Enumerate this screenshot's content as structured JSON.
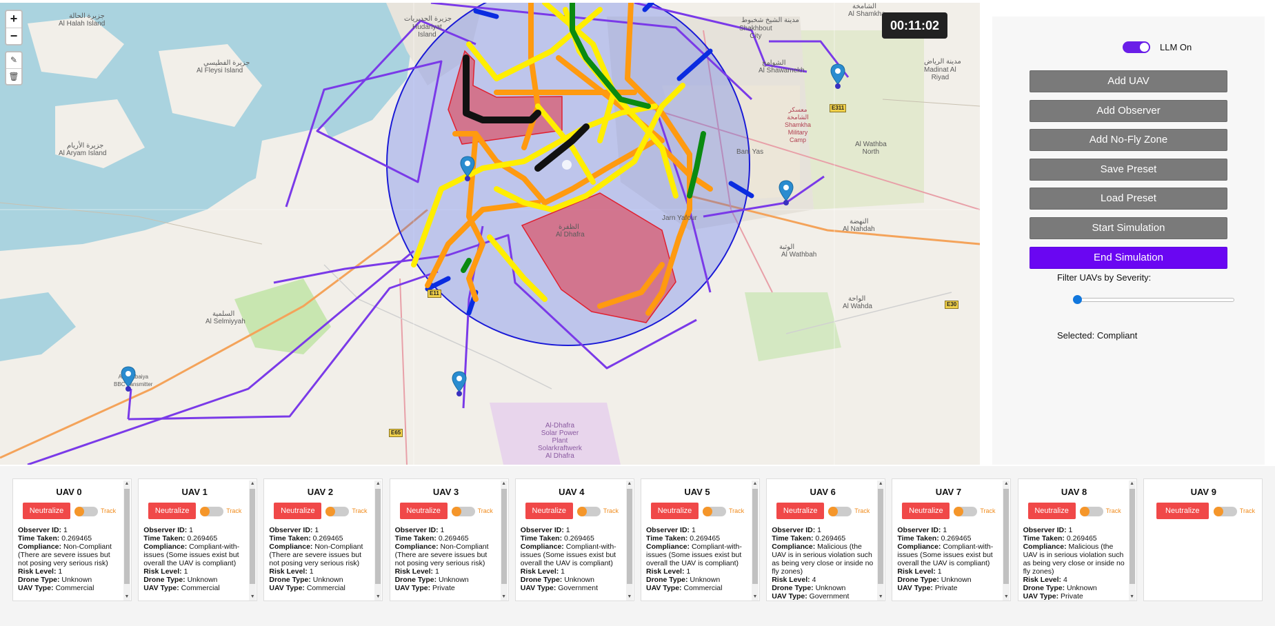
{
  "map": {
    "zoom_in": "+",
    "zoom_out": "−",
    "draw_icon": "edit-icon",
    "delete_icon": "trash-icon",
    "timer": "00:11:02",
    "labels": {
      "halah_ar": "جزيرة الحالة",
      "halah": "Al Halah Island",
      "hudariyat_ar": "جزيرة الحديريات",
      "hudariyat": "Hudariyat\nIsland",
      "fleisi_ar": "جزيرة الفطيسي",
      "fleisi": "Al Fleysi Island",
      "aryam_ar": "جزيرة الأريام",
      "aryam": "Al Aryam Island",
      "selmiyyah_ar": "السلمية",
      "selmiyyah": "Al Selmiyyah",
      "bbc": "Al-Dhabaiya\nBBC transmitter",
      "shamkha_ar": "الشامخة",
      "shamkha": "Al Shamkha",
      "shakhbout_ar": "مدينة الشيخ شخبوط",
      "shakhbout": "Shakhbout\nCity",
      "shawamekh_ar": "الشوامخ",
      "shawamekh": "Al Shawamekh",
      "riyad_ar": "مدينة الرياض",
      "riyad": "Madinat Al\nRiyad",
      "military": "معسكر\nالشامخة\nShamkha\nMilitary\nCamp",
      "wathba_north": "Al Wathba\nNorth",
      "baniyas": "Bani Yas",
      "nahdah_ar": "النهضة",
      "nahdah": "Al Nahdah",
      "wathbah_ar": "الوثبة",
      "wathbah": "Al Wathbah",
      "wahda_ar": "الواحة",
      "wahda": "Al Wahda",
      "dhafra_ar": "الظفرة",
      "dhafra": "Al Dhafra",
      "jarn": "Jarn Yafour",
      "solar": "Al-Dhafra\nSolar Power\nPlant\nSolarkraftwerk\nAl Dhafra",
      "e65": "E65",
      "e30": "E30",
      "e311": "E311",
      "e11": "E11"
    }
  },
  "panel": {
    "llm_label": "LLM On",
    "buttons": {
      "add_uav": "Add UAV",
      "add_observer": "Add Observer",
      "add_nfz": "Add No-Fly Zone",
      "save_preset": "Save Preset",
      "load_preset": "Load Preset",
      "start_sim": "Start Simulation",
      "end_sim": "End Simulation"
    },
    "filter_label": "Filter UAVs by Severity:",
    "slider_value": 0,
    "selected_label": "Selected: Compliant",
    "accent": "#6a06f2"
  },
  "cards": {
    "neutralize_label": "Neutralize",
    "track_label": "Track",
    "field_labels": {
      "observer": "Observer ID:",
      "time": "Time Taken:",
      "compliance": "Compliance:",
      "risk": "Risk Level:",
      "drone": "Drone Type:",
      "uav": "UAV Type:"
    },
    "uavs": [
      {
        "title": "UAV 0",
        "observer": "1",
        "time": "0.269465",
        "compliance": "Non-Compliant (There are severe issues but not posing very serious risk)",
        "risk": "1",
        "drone": "Unknown",
        "uav": "Commercial"
      },
      {
        "title": "UAV 1",
        "observer": "1",
        "time": "0.269465",
        "compliance": "Compliant-with-issues (Some issues exist but overall the UAV is compliant)",
        "risk": "1",
        "drone": "Unknown",
        "uav": "Commercial"
      },
      {
        "title": "UAV 2",
        "observer": "1",
        "time": "0.269465",
        "compliance": "Non-Compliant (There are severe issues but not posing very serious risk)",
        "risk": "1",
        "drone": "Unknown",
        "uav": "Commercial"
      },
      {
        "title": "UAV 3",
        "observer": "1",
        "time": "0.269465",
        "compliance": "Non-Compliant (There are severe issues but not posing very serious risk)",
        "risk": "1",
        "drone": "Unknown",
        "uav": "Private"
      },
      {
        "title": "UAV 4",
        "observer": "1",
        "time": "0.269465",
        "compliance": "Compliant-with-issues (Some issues exist but overall the UAV is compliant)",
        "risk": "1",
        "drone": "Unknown",
        "uav": "Government"
      },
      {
        "title": "UAV 5",
        "observer": "1",
        "time": "0.269465",
        "compliance": "Compliant-with-issues (Some issues exist but overall the UAV is compliant)",
        "risk": "1",
        "drone": "Unknown",
        "uav": "Commercial"
      },
      {
        "title": "UAV 6",
        "observer": "1",
        "time": "0.269465",
        "compliance": "Malicious (the UAV is in serious violation such as being very close or inside no fly zones)",
        "risk": "4",
        "drone": "Unknown",
        "uav": "Government"
      },
      {
        "title": "UAV 7",
        "observer": "1",
        "time": "0.269465",
        "compliance": "Compliant-with-issues (Some issues exist but overall the UAV is compliant)",
        "risk": "1",
        "drone": "Unknown",
        "uav": "Private"
      },
      {
        "title": "UAV 8",
        "observer": "1",
        "time": "0.269465",
        "compliance": "Malicious (the UAV is in serious violation such as being very close or inside no fly zones)",
        "risk": "4",
        "drone": "Unknown",
        "uav": "Private"
      },
      {
        "title": "UAV 9"
      }
    ]
  }
}
